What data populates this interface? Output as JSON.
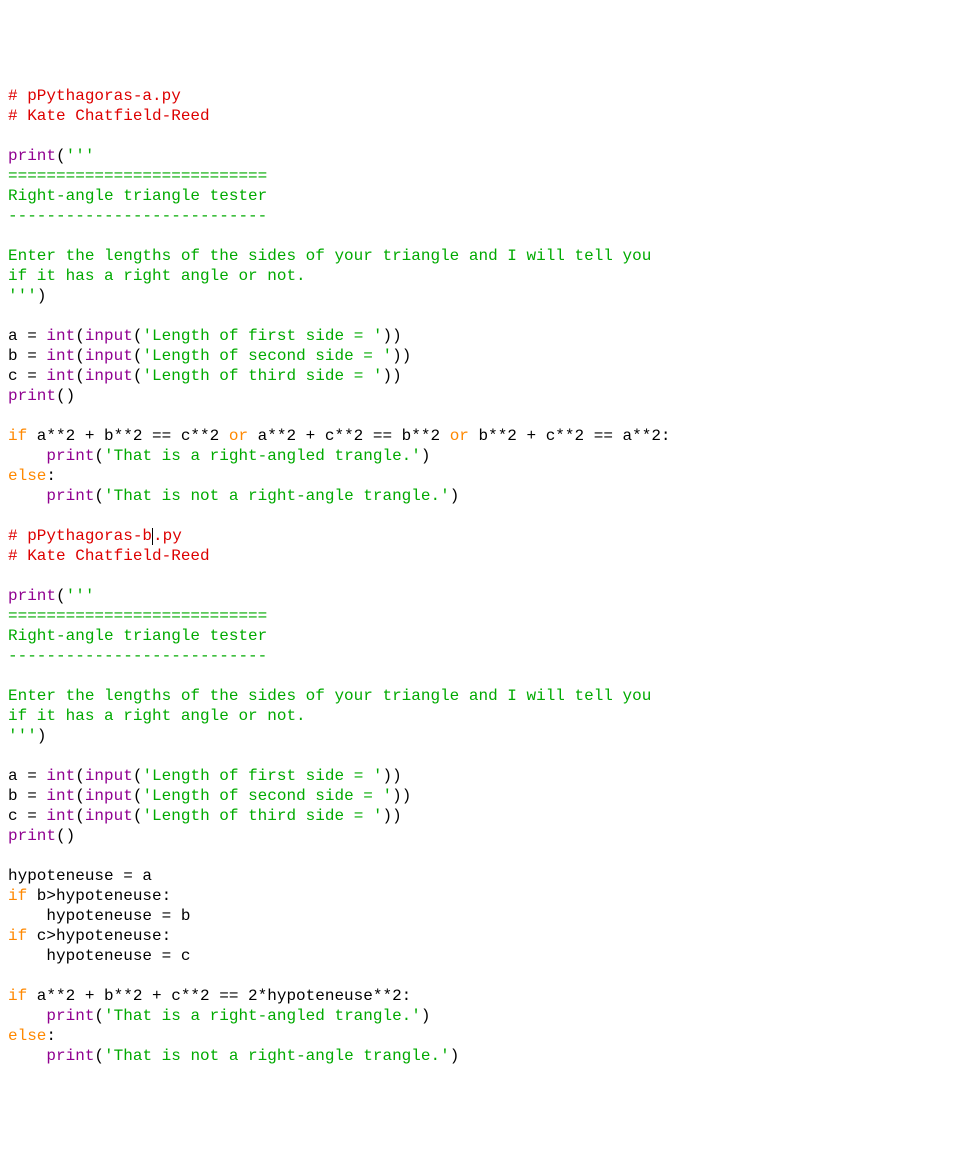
{
  "code": {
    "comment_file_a": "# pPythagoras-a.py",
    "comment_author": "# Kate Chatfield-Reed",
    "print_open": "print",
    "triple_open": "'''",
    "heading_rule_eq": "===========================",
    "heading_title": "Right-angle triangle tester",
    "heading_rule_dash": "---------------------------",
    "intro_line1": "Enter the lengths of the sides of your triangle and I will tell you",
    "intro_line2": "if it has a right angle or not.",
    "triple_close": "'''",
    "a_assign": "a = ",
    "b_assign": "b = ",
    "c_assign": "c = ",
    "int_call": "int",
    "input_call": "input",
    "prompt_a": "'Length of first side = '",
    "prompt_b": "'Length of second side = '",
    "prompt_c": "'Length of third side = '",
    "print_empty": "print",
    "paren_open": "(",
    "paren_close": ")",
    "paren_close2": "))",
    "if_kw": "if",
    "else_kw": "else",
    "or_kw": "or",
    "cond_a1": " a**2 + b**2 == c**2 ",
    "cond_a2": " a**2 + c**2 == b**2 ",
    "cond_a3": " b**2 + c**2 == a**2:",
    "indent": "    ",
    "msg_yes": "'That is a right-angled trangle.'",
    "msg_no": "'That is not a right-angle trangle.'",
    "colon": ":",
    "comment_file_b_pre": "# pPythagoras-b",
    "comment_file_b_post": ".py",
    "hyp_init": "hypoteneuse = a",
    "cond_b_gt": " b>hypoteneuse:",
    "hyp_b": "hypoteneuse = b",
    "cond_c_gt": " c>hypoteneuse:",
    "hyp_c": "hypoteneuse = c",
    "cond_final": " a**2 + b**2 + c**2 == 2*hypoteneuse**2:"
  }
}
